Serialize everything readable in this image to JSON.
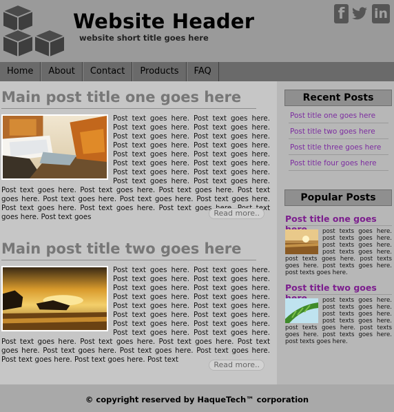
{
  "header": {
    "logo_icon": "stacked-cubes-icon",
    "title": "Website Header",
    "subtitle": "website short title goes here",
    "social": [
      {
        "name": "facebook-icon",
        "glyph": "f"
      },
      {
        "name": "twitter-icon",
        "glyph": "bird"
      },
      {
        "name": "linkedin-icon",
        "glyph": "in"
      }
    ]
  },
  "nav": {
    "items": [
      "Home",
      "About",
      "Contact",
      "Products",
      "FAQ"
    ]
  },
  "posts": [
    {
      "title": "Main post title one goes here",
      "body": "Post text goes here. Post text goes here. Post text goes here. Post text goes here. Post text goes here. Post text goes here. Post text goes here. Post text goes here. Post text goes here. Post text goes here. Post text goes here. Post text goes here. Post text goes here. Post text goes here. Post text goes here. Post text goes here. Post text goes here. Post text goes here. Post text goes here. Post text goes here. Post text goes here. Post text goes here. Post text goes here. Post text goes here. Post text goes here. Post text goes here. Post text goes here. Post text goes",
      "image": "waterfall-autumn-image",
      "read_more": "Read more.."
    },
    {
      "title": "Main post title two goes here",
      "body": "Post text goes here. Post text goes here. Post text goes here. Post text goes here. Post text goes here. Post text goes here. Post text goes here. Post text goes here. Post text goes here. Post text goes here. Post text goes here. Post text goes here. Post text goes here. Post text goes here. Post text goes here. Post text goes here. Post text goes here. Post text goes here. Post text goes here. Post text goes here. Post text goes here. Post text goes here. Post text goes here. Post text goes here. Post text goes here. Post text",
      "image": "sunset-seashore-image",
      "read_more": "Read more.."
    }
  ],
  "sidebar": {
    "recent_heading": "Recent Posts",
    "recent_items": [
      "Post title one goes here",
      "Post title two goes here",
      "Post title three goes here",
      "Post title four goes here"
    ],
    "popular_heading": "Popular Posts",
    "popular_items": [
      {
        "title": "Post title one goes here",
        "body": "post texts goes here. post texts goes here. post texts goes here. post texts goes here. post texts goes here. post texts goes here. post texts goes here. post texts goes here.",
        "image": "sunrise-field-thumbnail"
      },
      {
        "title": "Post title two goes here",
        "body": "post texts goes here. post texts goes here. post texts goes here. post texts goes here. post texts goes here. post texts goes here. post texts goes here. post texts goes here.",
        "image": "palm-leaf-thumbnail"
      }
    ]
  },
  "footer": {
    "copyright": "© copyright reserved by HaqueTech™ corporation"
  },
  "colors": {
    "header_bg": "#9a9a9a",
    "nav_bg": "#6a6a6a",
    "main_bg": "#c6c6c6",
    "sidebar_bg": "#b7b7b7",
    "post_title": "#777777",
    "link": "#7c2ca0"
  }
}
